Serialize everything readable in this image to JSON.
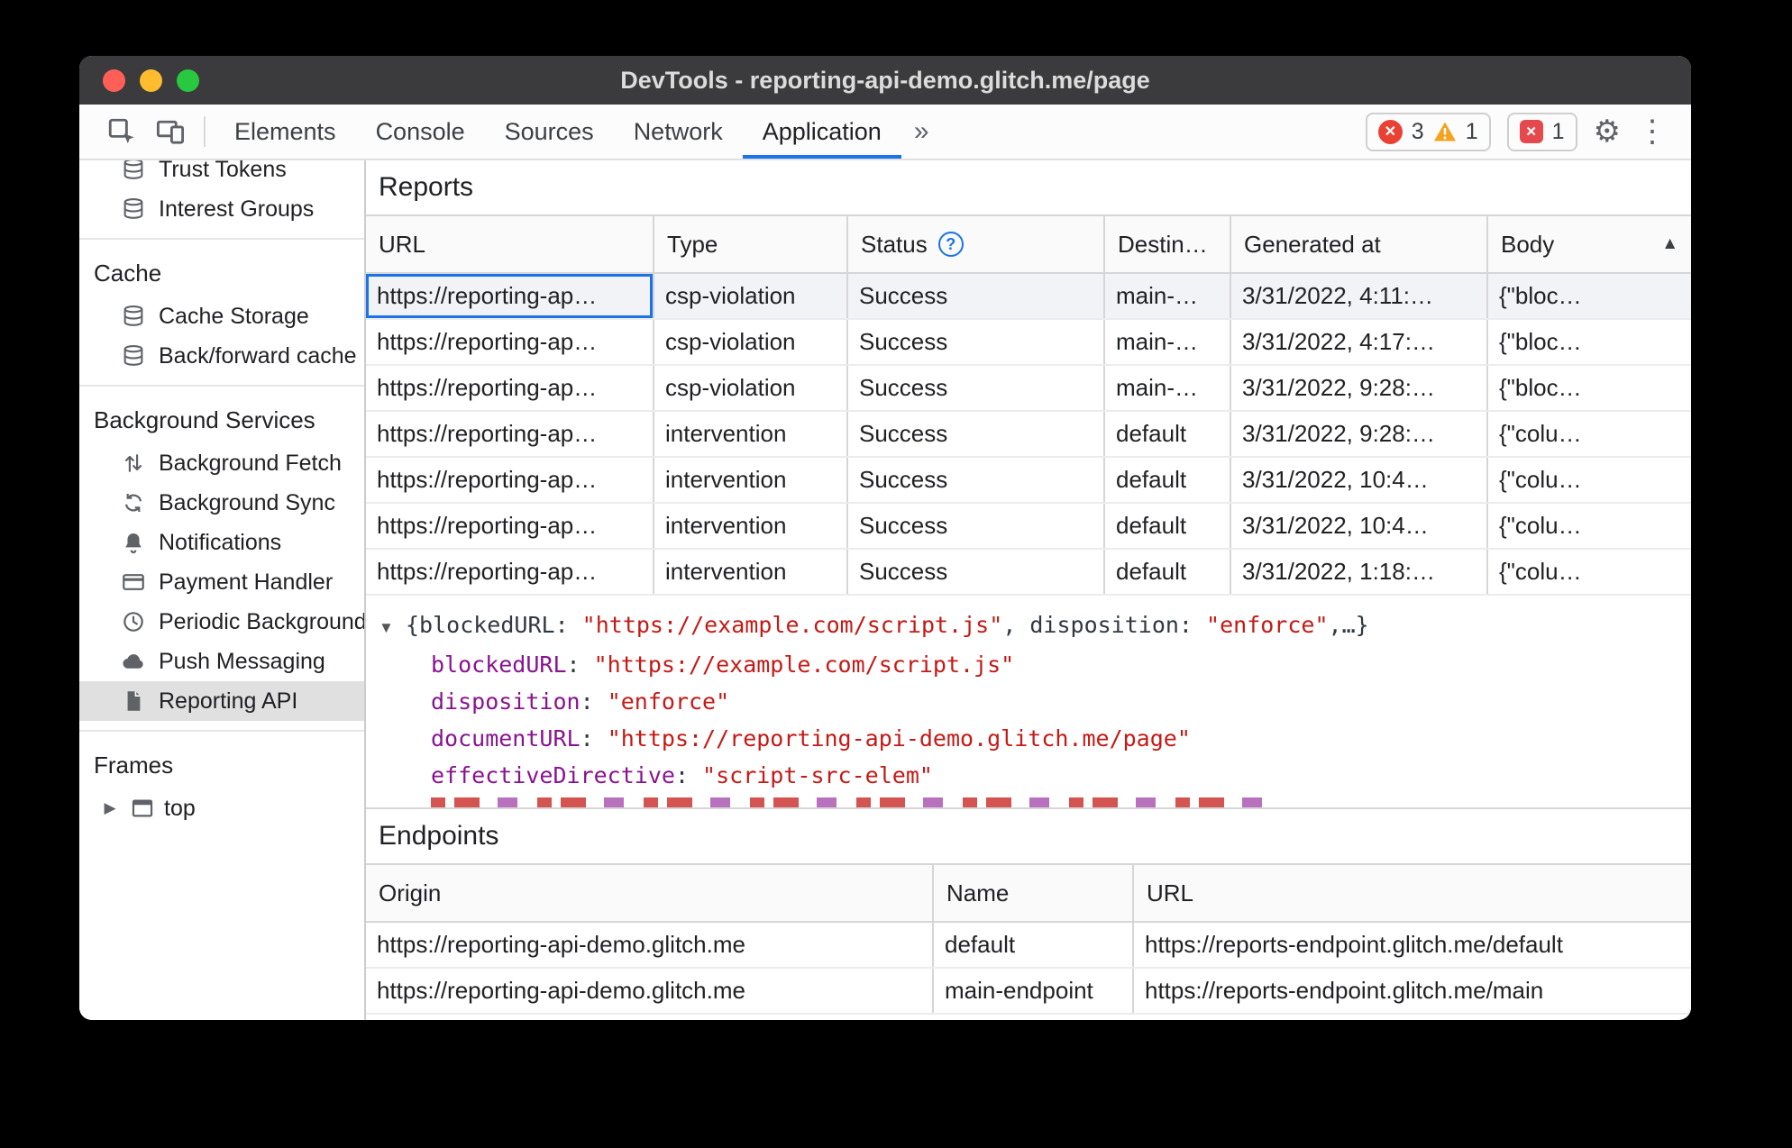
{
  "window": {
    "title": "DevTools - reporting-api-demo.glitch.me/page"
  },
  "toolbar": {
    "tabs": [
      "Elements",
      "Console",
      "Sources",
      "Network",
      "Application"
    ],
    "active_tab": "Application",
    "error_count": "3",
    "warning_count": "1",
    "issue_count": "1"
  },
  "icons": {
    "status_help": "?",
    "sort_asc": "▲",
    "expanded": "▼",
    "collapsed": "▶",
    "more_tabs": "»",
    "gear": "⚙",
    "overflow": "⋮",
    "error_x": "✕"
  },
  "sidebar": {
    "top_items": [
      {
        "label": "Trust Tokens",
        "icon": "database-icon"
      },
      {
        "label": "Interest Groups",
        "icon": "database-icon"
      }
    ],
    "sections": [
      {
        "title": "Cache",
        "items": [
          {
            "label": "Cache Storage",
            "icon": "database-icon"
          },
          {
            "label": "Back/forward cache",
            "icon": "database-icon"
          }
        ]
      },
      {
        "title": "Background Services",
        "items": [
          {
            "label": "Background Fetch",
            "icon": "background-fetch-icon"
          },
          {
            "label": "Background Sync",
            "icon": "background-sync-icon"
          },
          {
            "label": "Notifications",
            "icon": "bell-icon"
          },
          {
            "label": "Payment Handler",
            "icon": "payment-card-icon"
          },
          {
            "label": "Periodic Background",
            "icon": "clock-icon"
          },
          {
            "label": "Push Messaging",
            "icon": "cloud-icon"
          },
          {
            "label": "Reporting API",
            "icon": "document-icon",
            "selected": true
          }
        ]
      },
      {
        "title": "Frames",
        "items": [
          {
            "label": "top",
            "icon": "frame-icon",
            "expandable": true
          }
        ]
      }
    ]
  },
  "reports": {
    "title": "Reports",
    "columns": {
      "url": "URL",
      "type": "Type",
      "status": "Status",
      "destination": "Destin…",
      "generated": "Generated at",
      "body": "Body"
    },
    "rows": [
      {
        "url": "https://reporting-ap…",
        "type": "csp-violation",
        "status": "Success",
        "destination": "main-…",
        "generated": "3/31/2022, 4:11:…",
        "body": "{\"bloc…"
      },
      {
        "url": "https://reporting-ap…",
        "type": "csp-violation",
        "status": "Success",
        "destination": "main-…",
        "generated": "3/31/2022, 4:17:…",
        "body": "{\"bloc…"
      },
      {
        "url": "https://reporting-ap…",
        "type": "csp-violation",
        "status": "Success",
        "destination": "main-…",
        "generated": "3/31/2022, 9:28:…",
        "body": "{\"bloc…"
      },
      {
        "url": "https://reporting-ap…",
        "type": "intervention",
        "status": "Success",
        "destination": "default",
        "generated": "3/31/2022, 9:28:…",
        "body": "{\"colu…"
      },
      {
        "url": "https://reporting-ap…",
        "type": "intervention",
        "status": "Success",
        "destination": "default",
        "generated": "3/31/2022, 10:4…",
        "body": "{\"colu…"
      },
      {
        "url": "https://reporting-ap…",
        "type": "intervention",
        "status": "Success",
        "destination": "default",
        "generated": "3/31/2022, 10:4…",
        "body": "{\"colu…"
      },
      {
        "url": "https://reporting-ap…",
        "type": "intervention",
        "status": "Success",
        "destination": "default",
        "generated": "3/31/2022, 1:18:…",
        "body": "{\"colu…"
      }
    ]
  },
  "preview": {
    "summary_tokens": [
      {
        "text": "{blockedURL: ",
        "style": "plain"
      },
      {
        "text": "\"https://example.com/script.js\"",
        "style": "string"
      },
      {
        "text": ", disposition: ",
        "style": "plain"
      },
      {
        "text": "\"enforce\"",
        "style": "string"
      },
      {
        "text": ",…}",
        "style": "plain"
      }
    ],
    "colon": ": ",
    "properties": [
      {
        "key": "blockedURL",
        "value": "\"https://example.com/script.js\""
      },
      {
        "key": "disposition",
        "value": "\"enforce\""
      },
      {
        "key": "documentURL",
        "value": "\"https://reporting-api-demo.glitch.me/page\""
      },
      {
        "key": "effectiveDirective",
        "value": "\"script-src-elem\""
      }
    ]
  },
  "endpoints": {
    "title": "Endpoints",
    "columns": {
      "origin": "Origin",
      "name": "Name",
      "url": "URL"
    },
    "rows": [
      {
        "origin": "https://reporting-api-demo.glitch.me",
        "name": "default",
        "url": "https://reports-endpoint.glitch.me/default"
      },
      {
        "origin": "https://reporting-api-demo.glitch.me",
        "name": "main-endpoint",
        "url": "https://reports-endpoint.glitch.me/main"
      }
    ]
  },
  "colors": {
    "accent_blue": "#1a73e8",
    "error_red": "#e94235",
    "warning_yellow": "#f5a31f",
    "json_key_purple": "#881391",
    "json_string_red": "#c41a16",
    "sidebar_selected_bg": "#e0e0e0"
  }
}
